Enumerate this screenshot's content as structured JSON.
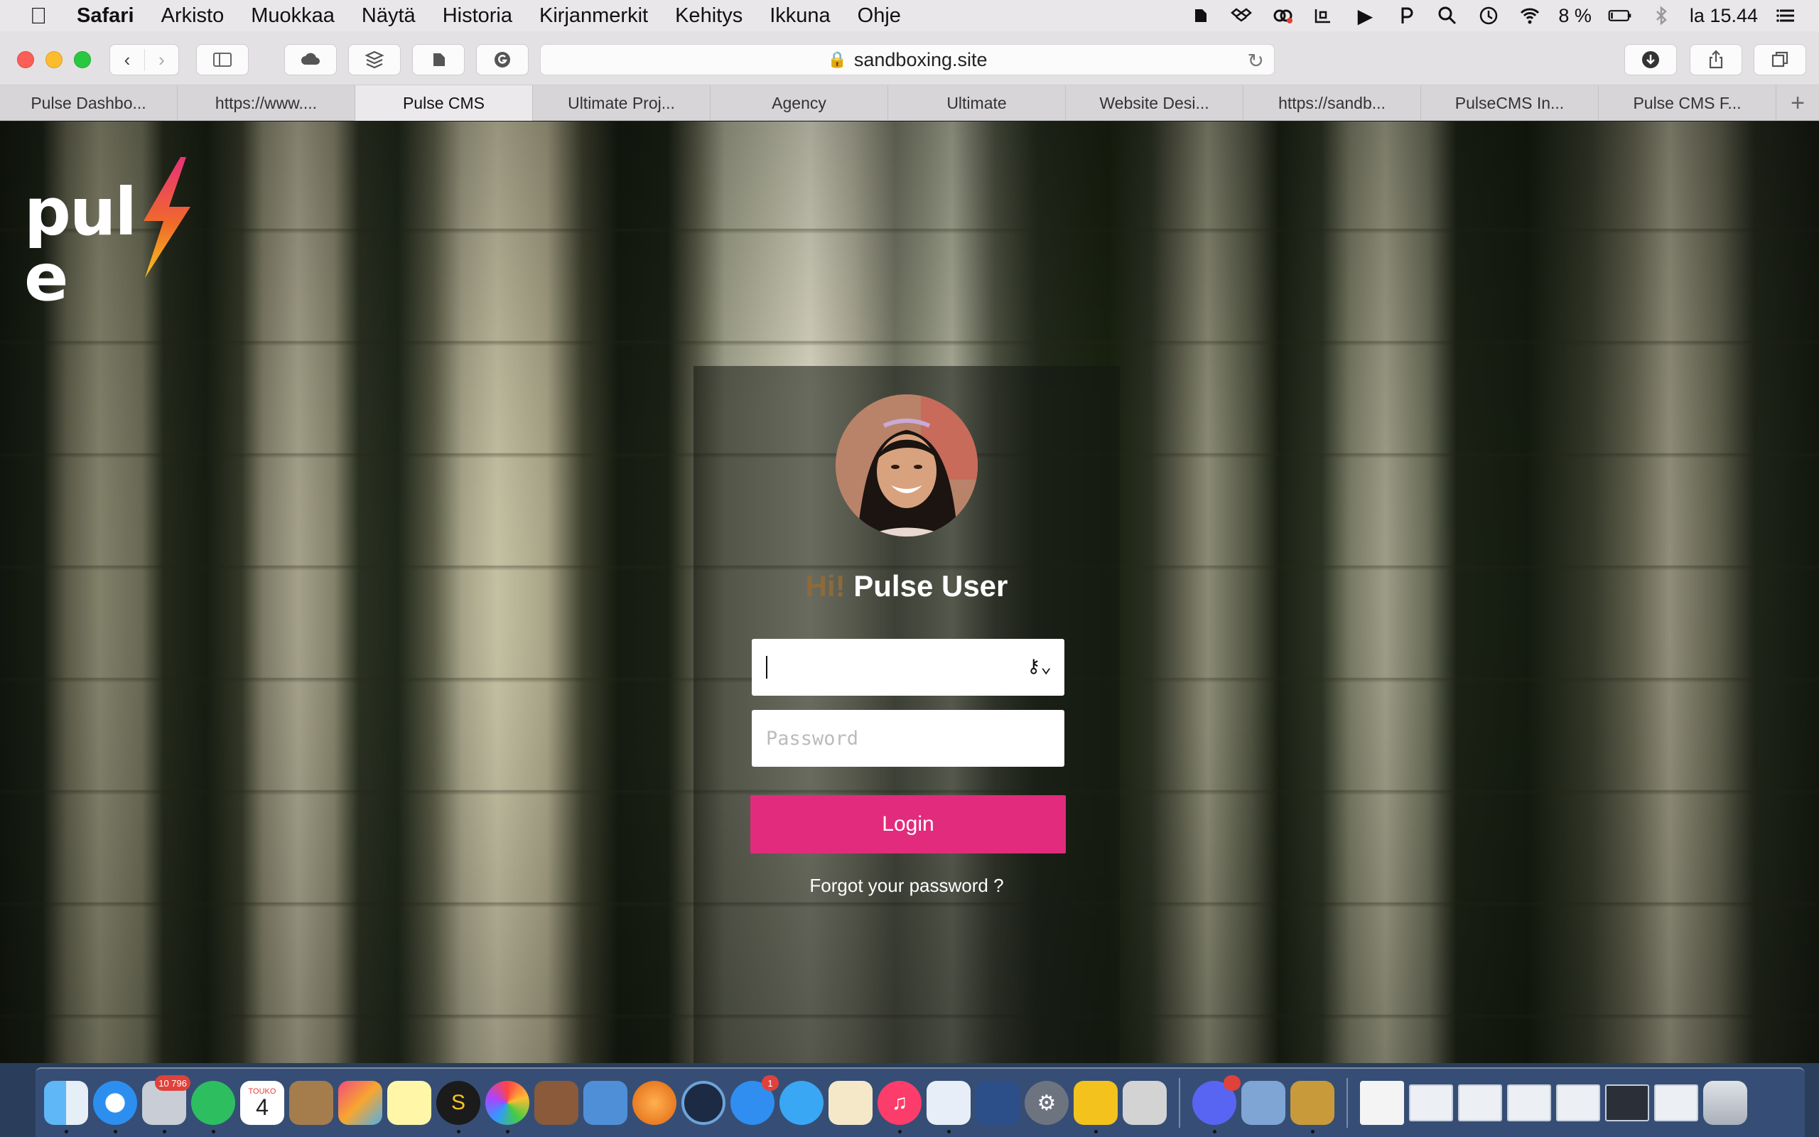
{
  "menubar": {
    "app_name": "Safari",
    "menus": [
      "Arkisto",
      "Muokkaa",
      "Näytä",
      "Historia",
      "Kirjanmerkit",
      "Kehitys",
      "Ikkuna",
      "Ohje"
    ],
    "battery": "8 %",
    "clock": "la 15.44"
  },
  "toolbar": {
    "url": "sandboxing.site"
  },
  "tabs": [
    {
      "label": "Pulse Dashbo..."
    },
    {
      "label": "https://www...."
    },
    {
      "label": "Pulse CMS"
    },
    {
      "label": "Ultimate Proj..."
    },
    {
      "label": "Agency"
    },
    {
      "label": "Ultimate"
    },
    {
      "label": "Website Desi..."
    },
    {
      "label": "https://sandb..."
    },
    {
      "label": "PulseCMS In..."
    },
    {
      "label": "Pulse CMS F..."
    }
  ],
  "page": {
    "logo_text_left": "pul",
    "logo_text_right": "e",
    "greeting_hi": "Hi!",
    "greeting_name": "Pulse User",
    "username_value": "",
    "password_placeholder": "Password",
    "login_label": "Login",
    "forgot_label": "Forgot your password ?"
  },
  "dock": {
    "mail_badge": "10 796",
    "calendar_month": "TOUKO",
    "calendar_day": "4",
    "appstore_badge": "1"
  },
  "colors": {
    "accent_login": "#e22b7d",
    "greeting_hi": "#8c6a3a"
  }
}
